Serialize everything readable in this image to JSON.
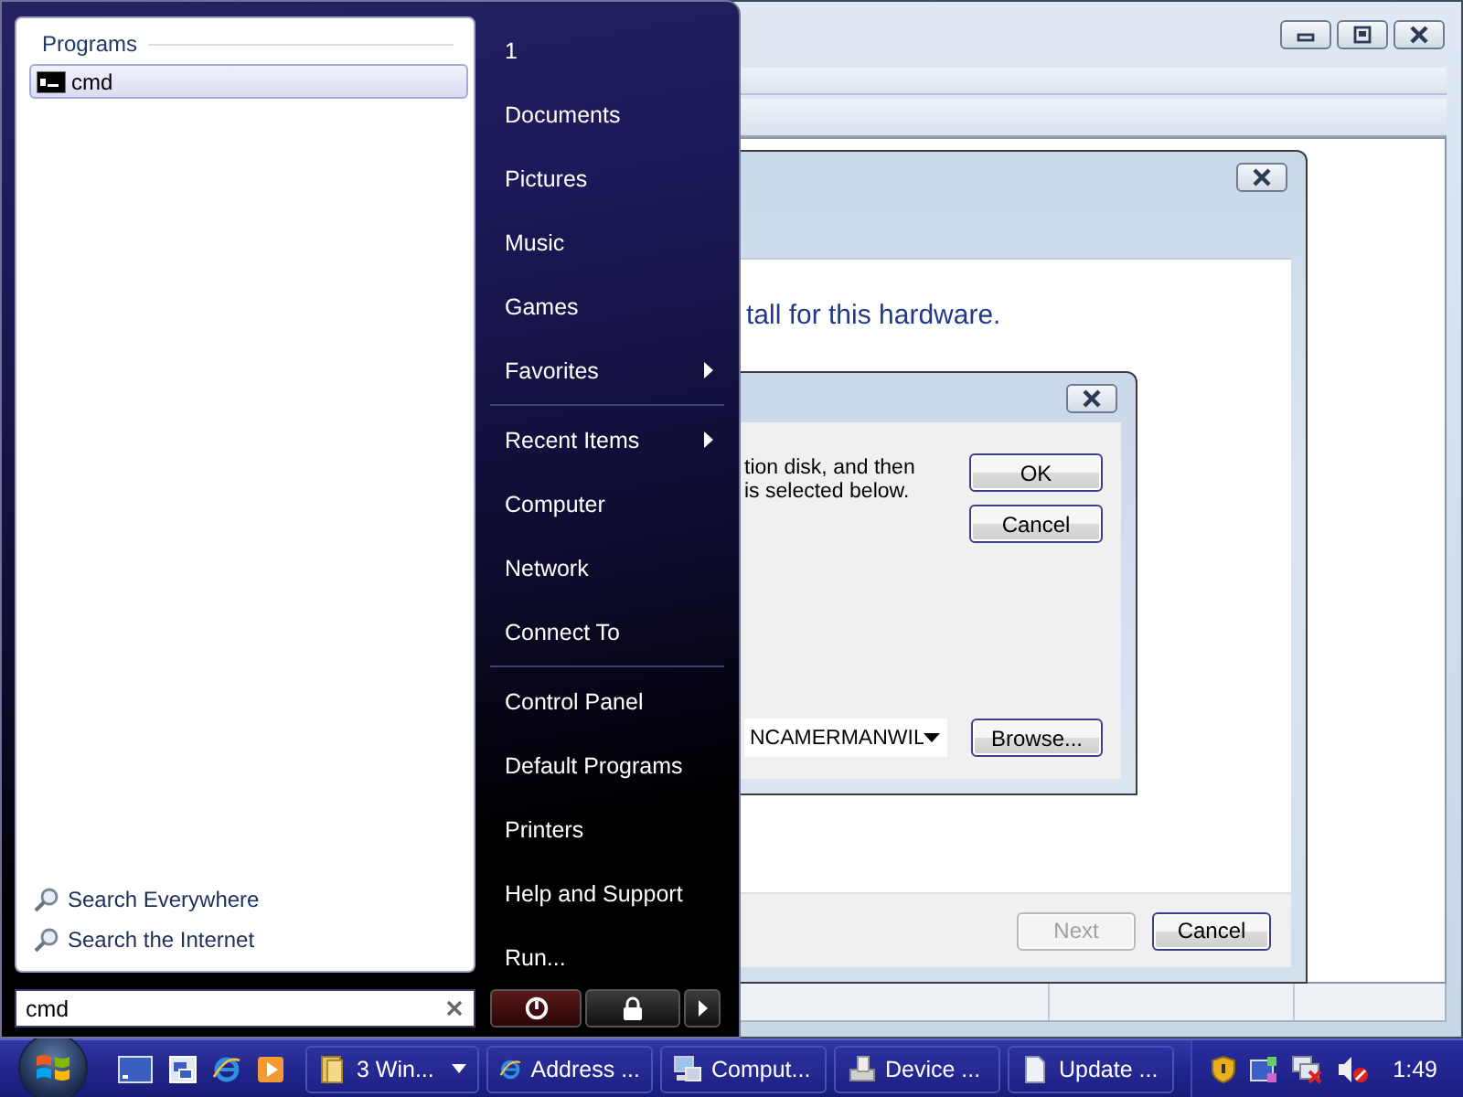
{
  "start_menu": {
    "programs_header": "Programs",
    "results": [
      {
        "label": "cmd",
        "selected": true
      }
    ],
    "search_links": [
      "Search Everywhere",
      "Search the Internet"
    ],
    "search": {
      "value": "cmd"
    },
    "place_groups": [
      [
        {
          "label": "1",
          "submenu": false
        },
        {
          "label": "Documents",
          "submenu": false
        },
        {
          "label": "Pictures",
          "submenu": false
        },
        {
          "label": "Music",
          "submenu": false
        },
        {
          "label": "Games",
          "submenu": false
        },
        {
          "label": "Favorites",
          "submenu": true
        }
      ],
      [
        {
          "label": "Recent Items",
          "submenu": true
        },
        {
          "label": "Computer",
          "submenu": false
        },
        {
          "label": "Network",
          "submenu": false
        },
        {
          "label": "Connect To",
          "submenu": false
        }
      ],
      [
        {
          "label": "Control Panel",
          "submenu": false
        },
        {
          "label": "Default Programs",
          "submenu": false
        },
        {
          "label": "Printers",
          "submenu": false
        },
        {
          "label": "Help and Support",
          "submenu": false
        },
        {
          "label": "Run...",
          "submenu": false
        }
      ]
    ]
  },
  "wizard": {
    "heading": "tall for this hardware.",
    "buttons": [
      {
        "label": "Next",
        "disabled": true
      },
      {
        "label": "Cancel",
        "disabled": false
      }
    ]
  },
  "disk_dialog": {
    "message_lines": [
      "tion disk, and then",
      "is selected below."
    ],
    "buttons": [
      "OK",
      "Cancel"
    ],
    "location": {
      "value": "NCAMERMANWIL"
    },
    "browse_button": "Browse..."
  },
  "taskbar": {
    "buttons": [
      {
        "label": "3 Win...",
        "grouped": true
      },
      {
        "label": "Address ...",
        "grouped": false
      },
      {
        "label": "Comput...",
        "grouped": false
      },
      {
        "label": "Device ...",
        "grouped": false
      },
      {
        "label": "Update ...",
        "grouped": false
      }
    ],
    "clock": "1:49"
  }
}
